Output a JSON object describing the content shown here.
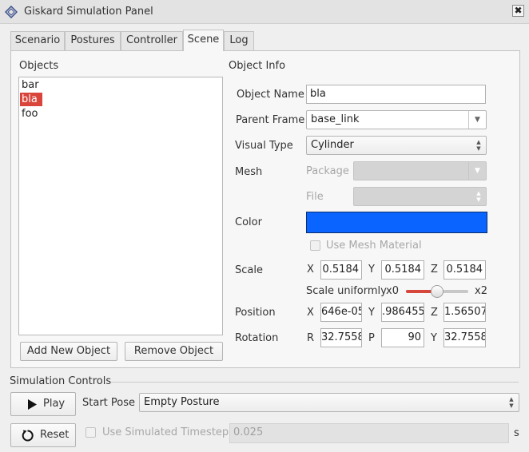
{
  "window": {
    "title": "Giskard Simulation Panel",
    "close_glyph": "✖"
  },
  "tabs": [
    {
      "label": "Scenario",
      "active": false
    },
    {
      "label": "Postures",
      "active": false
    },
    {
      "label": "Controller",
      "active": false
    },
    {
      "label": "Scene",
      "active": true
    },
    {
      "label": "Log",
      "active": false
    }
  ],
  "objects": {
    "header": "Objects",
    "items": [
      "bar",
      "bla",
      "foo"
    ],
    "selected": "bla",
    "add_button": "Add New Object",
    "remove_button": "Remove Object"
  },
  "object_info": {
    "header": "Object Info",
    "name_label": "Object Name",
    "name_value": "bla",
    "parent_label": "Parent Frame",
    "parent_value": "base_link",
    "visual_label": "Visual Type",
    "visual_value": "Cylinder",
    "mesh_label": "Mesh",
    "package_label": "Package",
    "file_label": "File",
    "color_label": "Color",
    "color_value": "#0a64ff",
    "use_mesh_material": "Use Mesh Material",
    "scale": {
      "label": "Scale",
      "x_label": "X",
      "x": "0.5184",
      "y_label": "Y",
      "y": "0.5184",
      "z_label": "Z",
      "z": "0.5184"
    },
    "scale_uniformly": {
      "label": "Scale uniformly",
      "min_label": "x0",
      "max_label": "x2",
      "level": 0.5
    },
    "position": {
      "label": "Position",
      "x_label": "X",
      "x": "646e-05",
      "y_label": "Y",
      "y": ".986455",
      "z_label": "Z",
      "z": "1.56507"
    },
    "rotation": {
      "label": "Rotation",
      "r_label": "R",
      "r": "32.7558",
      "p_label": "P",
      "p": "90",
      "y_label": "Y",
      "y": "32.7558"
    }
  },
  "simulation": {
    "header": "Simulation Controls",
    "play_button": "Play",
    "reset_button": "Reset",
    "start_pose_label": "Start Pose",
    "start_pose_value": "Empty Posture",
    "use_timestep_label": "Use Simulated Timestep",
    "timestep_value": "0.025",
    "timestep_unit": "s"
  },
  "colors": {
    "accent": "#d6463b",
    "selection": "#d9453a"
  }
}
